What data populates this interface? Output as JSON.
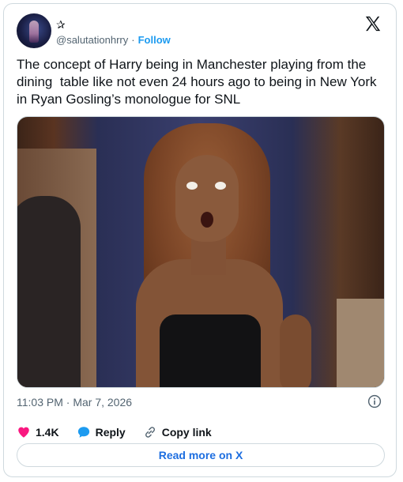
{
  "author": {
    "display_name_symbol": "✰",
    "handle": "@salutationhrry",
    "separator": "·",
    "follow_label": "Follow"
  },
  "tweet": {
    "text": "The concept of Harry being in Manchester playing from the dining  table like not even 24 hours ago to being in New York in Ryan Gosling’s monologue for SNL",
    "timestamp": "11:03 PM · Mar 7, 2026"
  },
  "actions": {
    "like_count": "1.4K",
    "reply_label": "Reply",
    "copy_link_label": "Copy link"
  },
  "footer": {
    "read_more_label": "Read more on X"
  },
  "colors": {
    "accent": "#1d9bf0",
    "like": "#f91880",
    "secondary_text": "#536471",
    "border": "#cfd9de"
  },
  "icons": [
    "x-logo-icon",
    "info-icon",
    "heart-icon",
    "reply-bubble-icon",
    "link-icon"
  ]
}
